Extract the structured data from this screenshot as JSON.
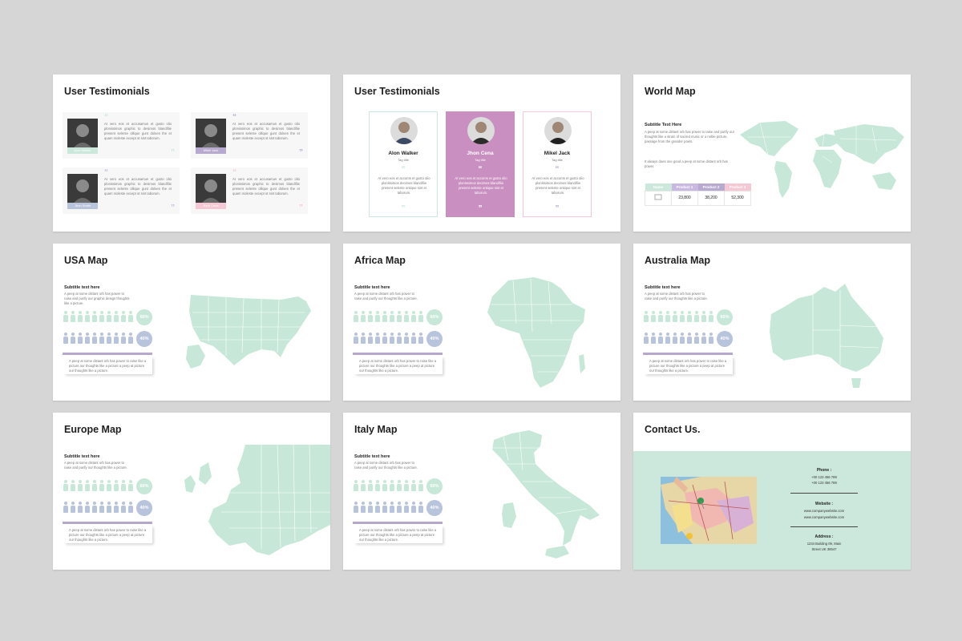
{
  "colors": {
    "mint": "#cce8dc",
    "lavender": "#b8a9cf",
    "pink": "#f4c8d4",
    "magenta": "#c98fc0",
    "map_fill": "#c7e8d8",
    "people_mint": "#c7e8d8",
    "people_lavender": "#b8c3dc"
  },
  "slides": {
    "testimonials_grid": {
      "title": "User Testimonials",
      "cards": [
        {
          "name": "Alon Walker",
          "text": "At vero eos et accusamus et gusto olio plonissimos graphic to desimos blandifiie present selente ollique gunt doloes the et quam moleste except ot sint taborum.",
          "icon": "quote-icon"
        },
        {
          "name": "Mikel Jack",
          "text": "At vero eos et accusamus et gusto olio plonissimos graphic to desimos blandifiie present selente ollique gunt doloes the et quam moleste except ot sint taborum.",
          "icon": "quote-icon"
        },
        {
          "name": "Jhon Smith",
          "text": "At vero eos et accusamus et gusto olio plonissimos graphic to desimos blandifiie present selente ollique gunt doloes the et quam moleste except ot sint taborum.",
          "icon": "quote-icon"
        },
        {
          "name": "Jhon Cena",
          "text": "At vero eos et accusamus et gusto olio plonissimos graphic to desimos blandifiie present selente ollique gunt doloes the et quam moleste except ot sint taborum.",
          "icon": "quote-icon"
        }
      ]
    },
    "testimonials_cards": {
      "title": "User Testimonials",
      "cards": [
        {
          "name": "Alon Walker",
          "tag": "Tag title",
          "text": "At vero eos et accoms et gusto olio plonissimos decimos blandifiie present selente ontique sint et taborum."
        },
        {
          "name": "Jhon Cena",
          "tag": "Tag title",
          "text": "At vero eos et accoms et gusto olio plonissimos decimos blandifiie present selente ontique sint et taborum."
        },
        {
          "name": "Mikel Jack",
          "tag": "Tag title",
          "text": "At vero eos et accoms et gusto olio plonissimos decimos blandifiie present selente ontique sint et taborum."
        }
      ]
    },
    "world_map": {
      "title": "World Map",
      "subtitle": "Subtitle Text Here",
      "desc1": "A peep at some distant orb has power to raise and purify our thoughts like a strain of sacred music or a noble picture, passage from the grander poets.",
      "desc2": "It always does one good a peep at some distant orb has power.",
      "table_headers": [
        "Name",
        "Product 1",
        "Product 2",
        "Product 3"
      ],
      "table_values": [
        "23,800",
        "38,200",
        "52,300"
      ]
    },
    "usa_map": {
      "title": "USA Map",
      "subtitle": "Subtitle text here",
      "desc": "A peep at some distant orb has power to raise and purify our graphic design thoughts like a picture.",
      "pct1": "60%",
      "pct2": "40%",
      "note": "A peep at some distant orb has power to raise like a picture our thoughts like a picture a peep at picture our thoughts like a picture."
    },
    "africa_map": {
      "title": "Africa Map",
      "subtitle": "Subtitle text here",
      "desc": "A peep at some distant orb has power to raise and purify our thoughts like a picture.",
      "pct1": "60%",
      "pct2": "40%",
      "note": "A peep at some distant orb has power to raise like a picture our thoughts like a picture a peep at picture our thoughts like a picture."
    },
    "australia_map": {
      "title": "Australia Map",
      "subtitle": "Subtitle text here",
      "desc": "A peep at some distant orb has power to raise and purify our thoughts like a picture.",
      "pct1": "60%",
      "pct2": "40%",
      "note": "A peep at some distant orb has power to raise like a picture our thoughts like a picture a peep at picture our thoughts like a picture."
    },
    "europe_map": {
      "title": "Europe Map",
      "subtitle": "Subtitle text here",
      "desc": "A peep at some distant orb has power to raise and purify our thoughts like a picture.",
      "pct1": "60%",
      "pct2": "40%",
      "note": "A peep at some distant orb has power to raise like a picture our thoughts like a picture a peep at picture our thoughts like a picture."
    },
    "italy_map": {
      "title": "Italy Map",
      "subtitle": "Subtitle text here",
      "desc": "A peep at some distant orb has power to raise and purify our thoughts like a picture.",
      "pct1": "60%",
      "pct2": "40%",
      "note": "A peep at some distant orb has power to raise like a picture our thoughts like a picture a peep at picture our thoughts like a picture."
    },
    "contact": {
      "title": "Contact Us.",
      "phone_label": "Phone :",
      "phone1": "+00 123 456 789",
      "phone2": "+00 123 456 789",
      "website_label": "Website :",
      "website1": "www.companywebsite.com",
      "website2": "www.companywebsite.com",
      "address_label": "Address :",
      "address1": "1234 Building 09, Main",
      "address2": "Street UK 39547"
    }
  }
}
